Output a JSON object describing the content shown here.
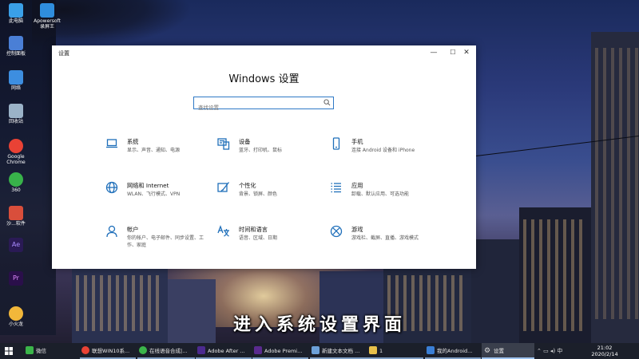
{
  "desktop": {
    "icons": [
      {
        "label": "此电脑",
        "icon": "computer-icon",
        "color": "#3aa0e8"
      },
      {
        "label": "Apowersoft\n录屏王",
        "icon": "recorder-icon",
        "color": "#2f8ddc"
      },
      {
        "label": "控制面板",
        "icon": "control-panel-icon",
        "color": "#4a7fd6"
      },
      {
        "label": "网络",
        "icon": "network-icon",
        "color": "#3d8ee0"
      },
      {
        "label": "回收站",
        "icon": "recycle-bin-icon",
        "color": "#9bb3c8"
      },
      {
        "label": "Google\nChrome",
        "icon": "chrome-icon",
        "color": "#e94235"
      },
      {
        "label": "360",
        "icon": "360-icon",
        "color": "#38b24a"
      },
      {
        "label": "沙...软件",
        "icon": "app-icon",
        "color": "#d94e3b"
      },
      {
        "label": "Ae",
        "icon": "after-effects-icon",
        "color": "#2a1a55"
      },
      {
        "label": "Pr",
        "icon": "premiere-icon",
        "color": "#2a0f4a"
      },
      {
        "label": "小火龙",
        "icon": "dragon-icon",
        "color": "#f2b73a"
      }
    ]
  },
  "window": {
    "title": "设置",
    "heading": "Windows 设置",
    "search_placeholder": "查找设置",
    "controls": {
      "minimize": "—",
      "maximize": "☐",
      "close": "✕"
    }
  },
  "categories": [
    {
      "title": "系统",
      "desc": "显示、声音、通知、电源",
      "icon": "laptop-icon"
    },
    {
      "title": "设备",
      "desc": "蓝牙、打印机、鼠标",
      "icon": "keyboard-icon"
    },
    {
      "title": "手机",
      "desc": "连接 Android 设备和 iPhone",
      "icon": "phone-icon"
    },
    {
      "title": "网络和 Internet",
      "desc": "WLAN、飞行模式、VPN",
      "icon": "globe-icon"
    },
    {
      "title": "个性化",
      "desc": "背景、锁屏、颜色",
      "icon": "brush-icon"
    },
    {
      "title": "应用",
      "desc": "卸载、默认应用、可选功能",
      "icon": "apps-list-icon"
    },
    {
      "title": "帐户",
      "desc": "你的帐户、电子邮件、同步设置、工作、家庭",
      "icon": "person-icon"
    },
    {
      "title": "时间和语言",
      "desc": "语音、区域、日期",
      "icon": "language-icon"
    },
    {
      "title": "游戏",
      "desc": "游戏栏、截屏、直播、游戏模式",
      "icon": "xbox-icon"
    }
  ],
  "subtitle": "进入系统设置界面",
  "taskbar": {
    "items": [
      {
        "label": "微信",
        "icon": "wechat-icon",
        "color": "#3bb54a",
        "state": ""
      },
      {
        "label": "联想WIN10系...",
        "icon": "chrome-icon",
        "color": "#e94235",
        "state": "open"
      },
      {
        "label": "在线语音合成|...",
        "icon": "browser-icon",
        "color": "#3bb54a",
        "state": "open"
      },
      {
        "label": "Adobe After ...",
        "icon": "after-effects-icon",
        "color": "#4c2a8f",
        "state": "open"
      },
      {
        "label": "Adobe Premi...",
        "icon": "premiere-icon",
        "color": "#5a2a8f",
        "state": "open"
      },
      {
        "label": "新建文本文档 ...",
        "icon": "notepad-icon",
        "color": "#6ca0d8",
        "state": "open"
      },
      {
        "label": "1",
        "icon": "folder-icon",
        "color": "#e8c04a",
        "state": "open"
      },
      {
        "label": "我的Android...",
        "icon": "phone-icon",
        "color": "#3a7fd6",
        "state": "open"
      },
      {
        "label": "设置",
        "icon": "gear-icon",
        "color": "#dddddd",
        "state": "active"
      }
    ],
    "tray": "⌃ ▭ ◂) 中",
    "time": "21:02",
    "date": "2020/2/14"
  }
}
